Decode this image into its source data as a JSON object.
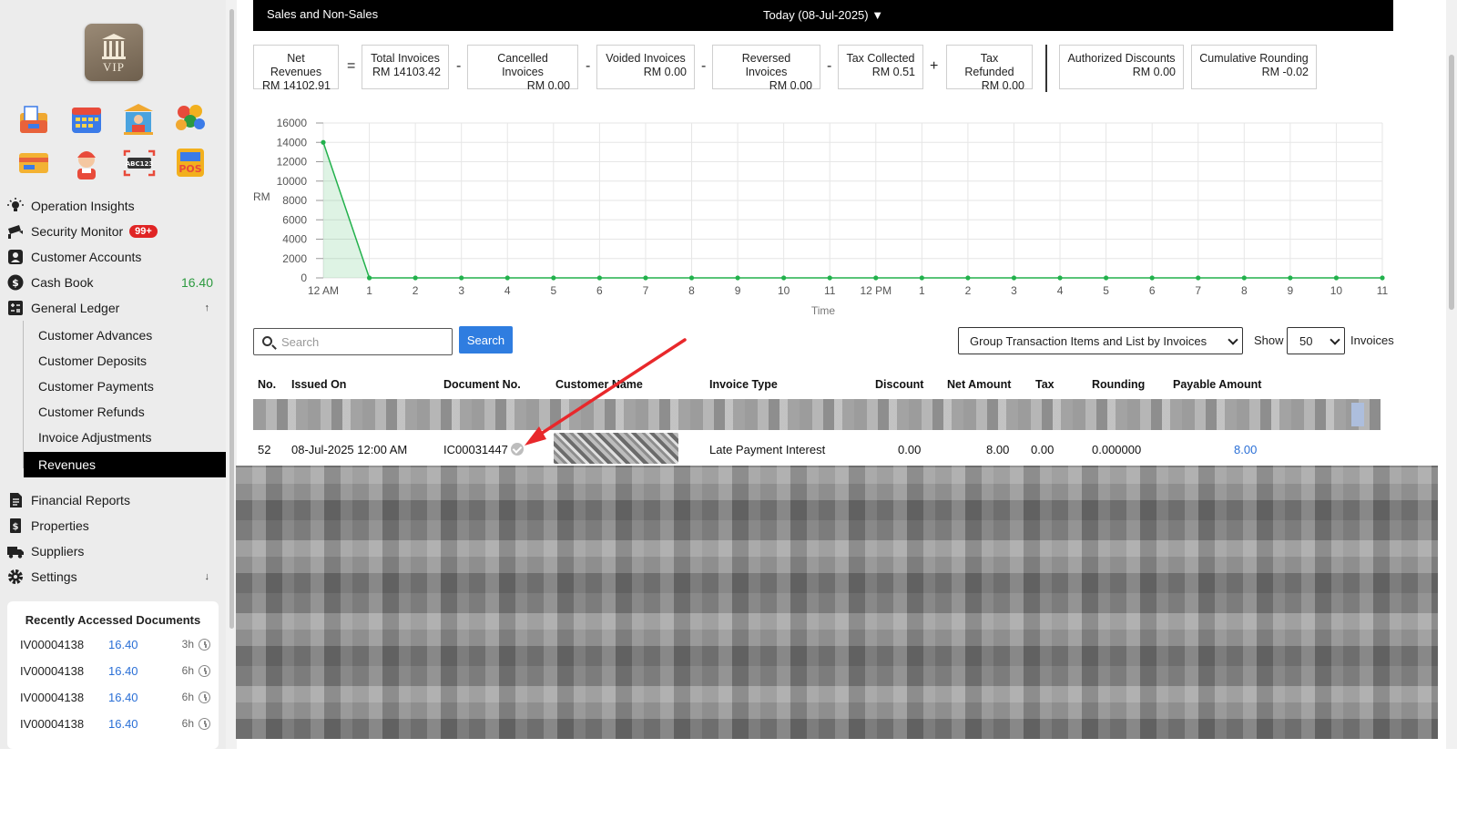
{
  "sidebar": {
    "logo_text": "VIP",
    "apps": [
      {
        "icon": "document-folder-icon",
        "color": "#f0a830"
      },
      {
        "icon": "calendar-icon",
        "color": "#3b7be8"
      },
      {
        "icon": "bank-user-icon",
        "color": "#4aa3df"
      },
      {
        "icon": "fruit-basket-icon",
        "color": "#e8623b"
      },
      {
        "icon": "credit-card-icon",
        "color": "#f3b233"
      },
      {
        "icon": "support-agent-icon",
        "color": "#e84b3b"
      },
      {
        "icon": "abc123-scan-icon",
        "color": "#444444"
      },
      {
        "icon": "pos-terminal-icon",
        "color": "#f2b01e"
      }
    ],
    "nav": [
      {
        "label": "Operation Insights",
        "icon": "lightbulb-icon"
      },
      {
        "label": "Security Monitor",
        "icon": "security-camera-icon",
        "badge": "99+"
      },
      {
        "label": "Customer Accounts",
        "icon": "user-account-icon"
      },
      {
        "label": "Cash Book",
        "icon": "dollar-coin-icon",
        "value": "16.40"
      },
      {
        "label": "General Ledger",
        "icon": "ledger-icon",
        "arrow": "↑"
      }
    ],
    "sub_nav": [
      {
        "label": "Customer Advances"
      },
      {
        "label": "Customer Deposits"
      },
      {
        "label": "Customer Payments"
      },
      {
        "label": "Customer Refunds"
      },
      {
        "label": "Invoice Adjustments"
      },
      {
        "label": "Revenues"
      }
    ],
    "nav2": [
      {
        "label": "Financial Reports",
        "icon": "report-icon"
      },
      {
        "label": "Properties",
        "icon": "building-icon"
      },
      {
        "label": "Suppliers",
        "icon": "truck-icon"
      },
      {
        "label": "Settings",
        "icon": "gear-icon",
        "arrow": "↓"
      }
    ],
    "recent": {
      "title": "Recently Accessed Documents",
      "rows": [
        {
          "doc": "IV00004138",
          "amount": "16.40",
          "age": "3h"
        },
        {
          "doc": "IV00004138",
          "amount": "16.40",
          "age": "6h"
        },
        {
          "doc": "IV00004138",
          "amount": "16.40",
          "age": "6h"
        },
        {
          "doc": "IV00004138",
          "amount": "16.40",
          "age": "6h"
        }
      ]
    }
  },
  "topbar": {
    "title": "Sales and Non-Sales",
    "date": "Today (08-Jul-2025) ▼"
  },
  "summary": {
    "boxes": [
      {
        "label": "Net Revenues",
        "value": "RM 14102.91"
      },
      {
        "label": "Total Invoices",
        "value": "RM 14103.42"
      },
      {
        "label": "Cancelled Invoices",
        "value": "RM 0.00"
      },
      {
        "label": "Voided Invoices",
        "value": "RM 0.00"
      },
      {
        "label": "Reversed Invoices",
        "value": "RM 0.00"
      },
      {
        "label": "Tax Collected",
        "value": "RM 0.51"
      },
      {
        "label": "Tax Refunded",
        "value": "RM 0.00"
      },
      {
        "label": "Authorized Discounts",
        "value": "RM 0.00"
      },
      {
        "label": "Cumulative Rounding",
        "value": "RM -0.02"
      }
    ],
    "operators": [
      "=",
      "-",
      "-",
      "-",
      "-",
      "+"
    ]
  },
  "chart_data": {
    "type": "area",
    "title": "",
    "xlabel": "Time",
    "ylabel": "RM",
    "ylim": [
      0,
      16000
    ],
    "yticks": [
      0,
      2000,
      4000,
      6000,
      8000,
      10000,
      12000,
      14000,
      16000
    ],
    "categories": [
      "12 AM",
      "1",
      "2",
      "3",
      "4",
      "5",
      "6",
      "7",
      "8",
      "9",
      "10",
      "11",
      "12 PM",
      "1",
      "2",
      "3",
      "4",
      "5",
      "6",
      "7",
      "8",
      "9",
      "10",
      "11"
    ],
    "values": [
      14000,
      0,
      0,
      0,
      0,
      0,
      0,
      0,
      0,
      0,
      0,
      0,
      0,
      0,
      0,
      0,
      0,
      0,
      0,
      0,
      0,
      0,
      0,
      0
    ],
    "grid": true,
    "color": "#22b14c"
  },
  "controls": {
    "search_placeholder": "Search",
    "search_button": "Search",
    "group_select": "Group Transaction Items and List by Invoices",
    "show_label": "Show",
    "show_value": "50",
    "invoices_label": "Invoices"
  },
  "table": {
    "headers": [
      "No.",
      "Issued On",
      "Document No.",
      "Customer Name",
      "Invoice Type",
      "Discount",
      "Net Amount",
      "Tax",
      "Rounding",
      "Payable Amount"
    ],
    "row": {
      "no": "52",
      "issued_on": "08-Jul-2025 12:00 AM",
      "document_no": "IC00031447",
      "invoice_type": "Late Payment Interest",
      "discount": "0.00",
      "net_amount": "8.00",
      "tax": "0.00",
      "rounding": "0.000000",
      "payable_amount": "8.00"
    }
  },
  "colors": {
    "accent_blue": "#2f7de0",
    "link_blue": "#2a6fd6",
    "annotation_red": "#e8282b",
    "cash_green": "#2c9a3f"
  }
}
